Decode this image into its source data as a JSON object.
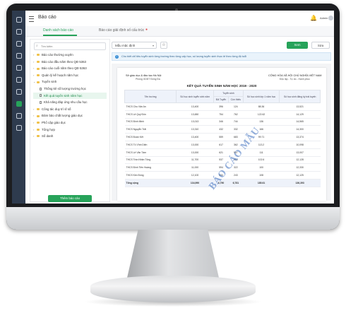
{
  "app": {
    "title": "Báo cáo",
    "user": "Admin"
  },
  "tabs": [
    {
      "label": "Danh sách báo cáo",
      "active": true
    },
    {
      "label": "Báo cáo giải định số cấu trúc",
      "active": false
    }
  ],
  "sidebar": {
    "search_placeholder": "Tìm kiếm",
    "items": [
      {
        "label": "Báo cáo thường xuyên",
        "type": "folder"
      },
      {
        "label": "Báo cáo đầu năm theo QĐ 5363",
        "type": "folder"
      },
      {
        "label": "Báo cáo cuối năm theo QĐ 5363",
        "type": "folder"
      },
      {
        "label": "Quản lý kế hoạch năm học",
        "type": "folder"
      },
      {
        "label": "Tuyển sinh",
        "type": "folder",
        "expanded": true
      },
      {
        "label": "Thống kê số lượng trường học",
        "type": "doc",
        "child": true
      },
      {
        "label": "Kết quả tuyển sinh năm học",
        "type": "doc",
        "child": true,
        "selected": true
      },
      {
        "label": "Khả năng đáp ứng nhu cầu học",
        "type": "doc",
        "child": true
      },
      {
        "label": "Công tác duy trì sĩ số",
        "type": "folder"
      },
      {
        "label": "Đảm bảo chất lượng giáo dục",
        "type": "folder"
      },
      {
        "label": "Phổ cập giáo dục",
        "type": "folder"
      },
      {
        "label": "Tổng hợp",
        "type": "folder"
      },
      {
        "label": "Số danh",
        "type": "folder"
      }
    ],
    "create_button": "Thêm báo cáo"
  },
  "toolbar": {
    "template_select": "Mẫu mặc định",
    "save_label": "Xem",
    "edit_label": "Sửa"
  },
  "info_text": "Cho biết chỉ tiêu tuyển sinh từng trường theo từng cấp học, số lượng tuyển sinh thực tế theo từng độ tuổi",
  "report": {
    "header_left_1": "Sở giáo dục & đào tạo Hà Nội",
    "header_left_2": "Phòng GDĐT Đống Đa",
    "header_right_1": "CỘNG HÒA XÃ HỘI CHỦ NGHĨA VIỆT NAM",
    "header_right_2": "Độc lập - Tự do - Hạnh phúc",
    "title": "KẾT QUẢ TUYỂN SINH NĂM HỌC 2019 - 2020",
    "group_header": "Tuyển sinh",
    "columns": [
      "Tên trường",
      "Số học sinh tuyển sinh năm",
      "Đã Tuyển",
      "Còn thiếu",
      "Số học sinh lớp 1 năm học",
      "Số học sinh đăng ký trái tuyến"
    ],
    "rows": [
      [
        "THCS Chu Văn An",
        "13,400",
        "396",
        "124",
        "88.36",
        "13,521"
      ],
      [
        "THCS Lê Quý Đôn",
        "13,650",
        "754",
        "762",
        "122.62",
        "14,129"
      ],
      [
        "THCS Bình Minh",
        "13,013",
        "346",
        "744",
        "136",
        "14,565"
      ],
      [
        "THCS Nguyễn Trãi",
        "13,310",
        "432",
        "332",
        "166",
        "14,300"
      ],
      [
        "THCS Đoàn Kết",
        "13,400",
        "559",
        "683",
        "99.71",
        "13,374"
      ],
      [
        "THCS Tô Vĩnh Diện",
        "13,000",
        "617",
        "362",
        "113.2",
        "10,098"
      ],
      [
        "THCS Lê Văn Tám",
        "13,000",
        "621",
        "567",
        "111",
        "13,007"
      ],
      [
        "THCS Trần Nhân Tông",
        "11,700",
        "537",
        "413",
        "102.6",
        "12,128"
      ],
      [
        "THCS Đinh Tiên Hoàng",
        "11,000",
        "594",
        "322",
        "100",
        "12,330"
      ],
      [
        "THCS Kim Đồng",
        "12,100",
        "534",
        "243",
        "108",
        "12,125"
      ]
    ],
    "total": [
      "Tổng cộng",
      "134,990",
      "6,790",
      "6,781",
      "185.61",
      "136,393"
    ]
  },
  "watermark": "BÁO CÁO MẪU"
}
